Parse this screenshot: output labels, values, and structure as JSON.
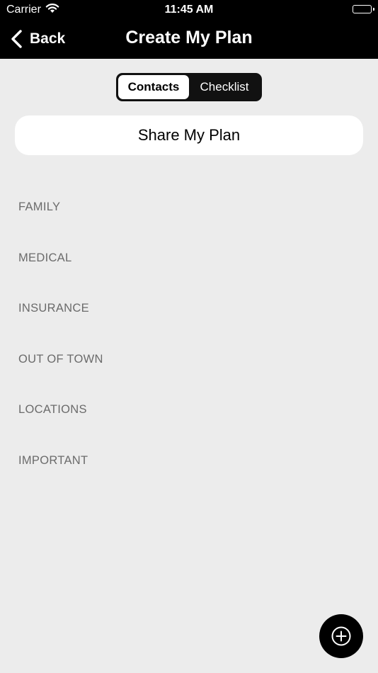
{
  "status_bar": {
    "carrier": "Carrier",
    "time": "11:45 AM"
  },
  "nav": {
    "back_label": "Back",
    "title": "Create My Plan"
  },
  "tabs": [
    {
      "label": "Contacts",
      "selected": true
    },
    {
      "label": "Checklist",
      "selected": false
    }
  ],
  "share_button_label": "Share My Plan",
  "categories": [
    "FAMILY",
    "MEDICAL",
    "INSURANCE",
    "OUT OF TOWN",
    "LOCATIONS",
    "IMPORTANT"
  ],
  "colors": {
    "nav_background": "#000000",
    "page_background": "#ececec",
    "category_text": "#6b6b6b"
  },
  "icons": {
    "back": "chevron-left-icon",
    "add": "plus-circle-icon",
    "wifi": "wifi-icon",
    "battery": "battery-icon"
  }
}
